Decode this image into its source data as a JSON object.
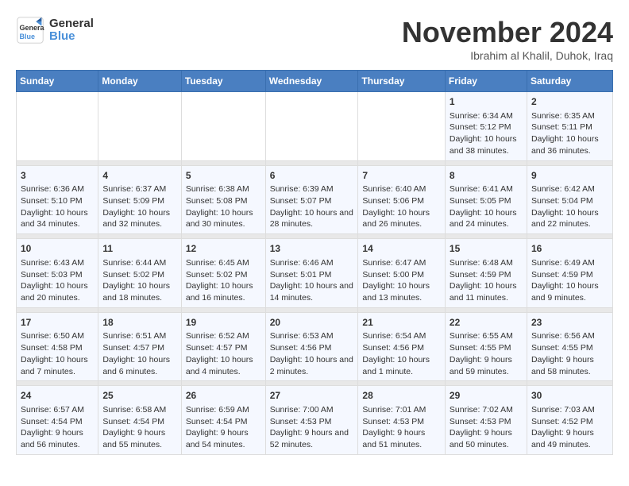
{
  "logo": {
    "line1": "General",
    "line2": "Blue"
  },
  "title": "November 2024",
  "location": "Ibrahim al Khalil, Duhok, Iraq",
  "days_of_week": [
    "Sunday",
    "Monday",
    "Tuesday",
    "Wednesday",
    "Thursday",
    "Friday",
    "Saturday"
  ],
  "weeks": [
    [
      {
        "day": "",
        "info": ""
      },
      {
        "day": "",
        "info": ""
      },
      {
        "day": "",
        "info": ""
      },
      {
        "day": "",
        "info": ""
      },
      {
        "day": "",
        "info": ""
      },
      {
        "day": "1",
        "info": "Sunrise: 6:34 AM\nSunset: 5:12 PM\nDaylight: 10 hours and 38 minutes."
      },
      {
        "day": "2",
        "info": "Sunrise: 6:35 AM\nSunset: 5:11 PM\nDaylight: 10 hours and 36 minutes."
      }
    ],
    [
      {
        "day": "3",
        "info": "Sunrise: 6:36 AM\nSunset: 5:10 PM\nDaylight: 10 hours and 34 minutes."
      },
      {
        "day": "4",
        "info": "Sunrise: 6:37 AM\nSunset: 5:09 PM\nDaylight: 10 hours and 32 minutes."
      },
      {
        "day": "5",
        "info": "Sunrise: 6:38 AM\nSunset: 5:08 PM\nDaylight: 10 hours and 30 minutes."
      },
      {
        "day": "6",
        "info": "Sunrise: 6:39 AM\nSunset: 5:07 PM\nDaylight: 10 hours and 28 minutes."
      },
      {
        "day": "7",
        "info": "Sunrise: 6:40 AM\nSunset: 5:06 PM\nDaylight: 10 hours and 26 minutes."
      },
      {
        "day": "8",
        "info": "Sunrise: 6:41 AM\nSunset: 5:05 PM\nDaylight: 10 hours and 24 minutes."
      },
      {
        "day": "9",
        "info": "Sunrise: 6:42 AM\nSunset: 5:04 PM\nDaylight: 10 hours and 22 minutes."
      }
    ],
    [
      {
        "day": "10",
        "info": "Sunrise: 6:43 AM\nSunset: 5:03 PM\nDaylight: 10 hours and 20 minutes."
      },
      {
        "day": "11",
        "info": "Sunrise: 6:44 AM\nSunset: 5:02 PM\nDaylight: 10 hours and 18 minutes."
      },
      {
        "day": "12",
        "info": "Sunrise: 6:45 AM\nSunset: 5:02 PM\nDaylight: 10 hours and 16 minutes."
      },
      {
        "day": "13",
        "info": "Sunrise: 6:46 AM\nSunset: 5:01 PM\nDaylight: 10 hours and 14 minutes."
      },
      {
        "day": "14",
        "info": "Sunrise: 6:47 AM\nSunset: 5:00 PM\nDaylight: 10 hours and 13 minutes."
      },
      {
        "day": "15",
        "info": "Sunrise: 6:48 AM\nSunset: 4:59 PM\nDaylight: 10 hours and 11 minutes."
      },
      {
        "day": "16",
        "info": "Sunrise: 6:49 AM\nSunset: 4:59 PM\nDaylight: 10 hours and 9 minutes."
      }
    ],
    [
      {
        "day": "17",
        "info": "Sunrise: 6:50 AM\nSunset: 4:58 PM\nDaylight: 10 hours and 7 minutes."
      },
      {
        "day": "18",
        "info": "Sunrise: 6:51 AM\nSunset: 4:57 PM\nDaylight: 10 hours and 6 minutes."
      },
      {
        "day": "19",
        "info": "Sunrise: 6:52 AM\nSunset: 4:57 PM\nDaylight: 10 hours and 4 minutes."
      },
      {
        "day": "20",
        "info": "Sunrise: 6:53 AM\nSunset: 4:56 PM\nDaylight: 10 hours and 2 minutes."
      },
      {
        "day": "21",
        "info": "Sunrise: 6:54 AM\nSunset: 4:56 PM\nDaylight: 10 hours and 1 minute."
      },
      {
        "day": "22",
        "info": "Sunrise: 6:55 AM\nSunset: 4:55 PM\nDaylight: 9 hours and 59 minutes."
      },
      {
        "day": "23",
        "info": "Sunrise: 6:56 AM\nSunset: 4:55 PM\nDaylight: 9 hours and 58 minutes."
      }
    ],
    [
      {
        "day": "24",
        "info": "Sunrise: 6:57 AM\nSunset: 4:54 PM\nDaylight: 9 hours and 56 minutes."
      },
      {
        "day": "25",
        "info": "Sunrise: 6:58 AM\nSunset: 4:54 PM\nDaylight: 9 hours and 55 minutes."
      },
      {
        "day": "26",
        "info": "Sunrise: 6:59 AM\nSunset: 4:54 PM\nDaylight: 9 hours and 54 minutes."
      },
      {
        "day": "27",
        "info": "Sunrise: 7:00 AM\nSunset: 4:53 PM\nDaylight: 9 hours and 52 minutes."
      },
      {
        "day": "28",
        "info": "Sunrise: 7:01 AM\nSunset: 4:53 PM\nDaylight: 9 hours and 51 minutes."
      },
      {
        "day": "29",
        "info": "Sunrise: 7:02 AM\nSunset: 4:53 PM\nDaylight: 9 hours and 50 minutes."
      },
      {
        "day": "30",
        "info": "Sunrise: 7:03 AM\nSunset: 4:52 PM\nDaylight: 9 hours and 49 minutes."
      }
    ]
  ]
}
